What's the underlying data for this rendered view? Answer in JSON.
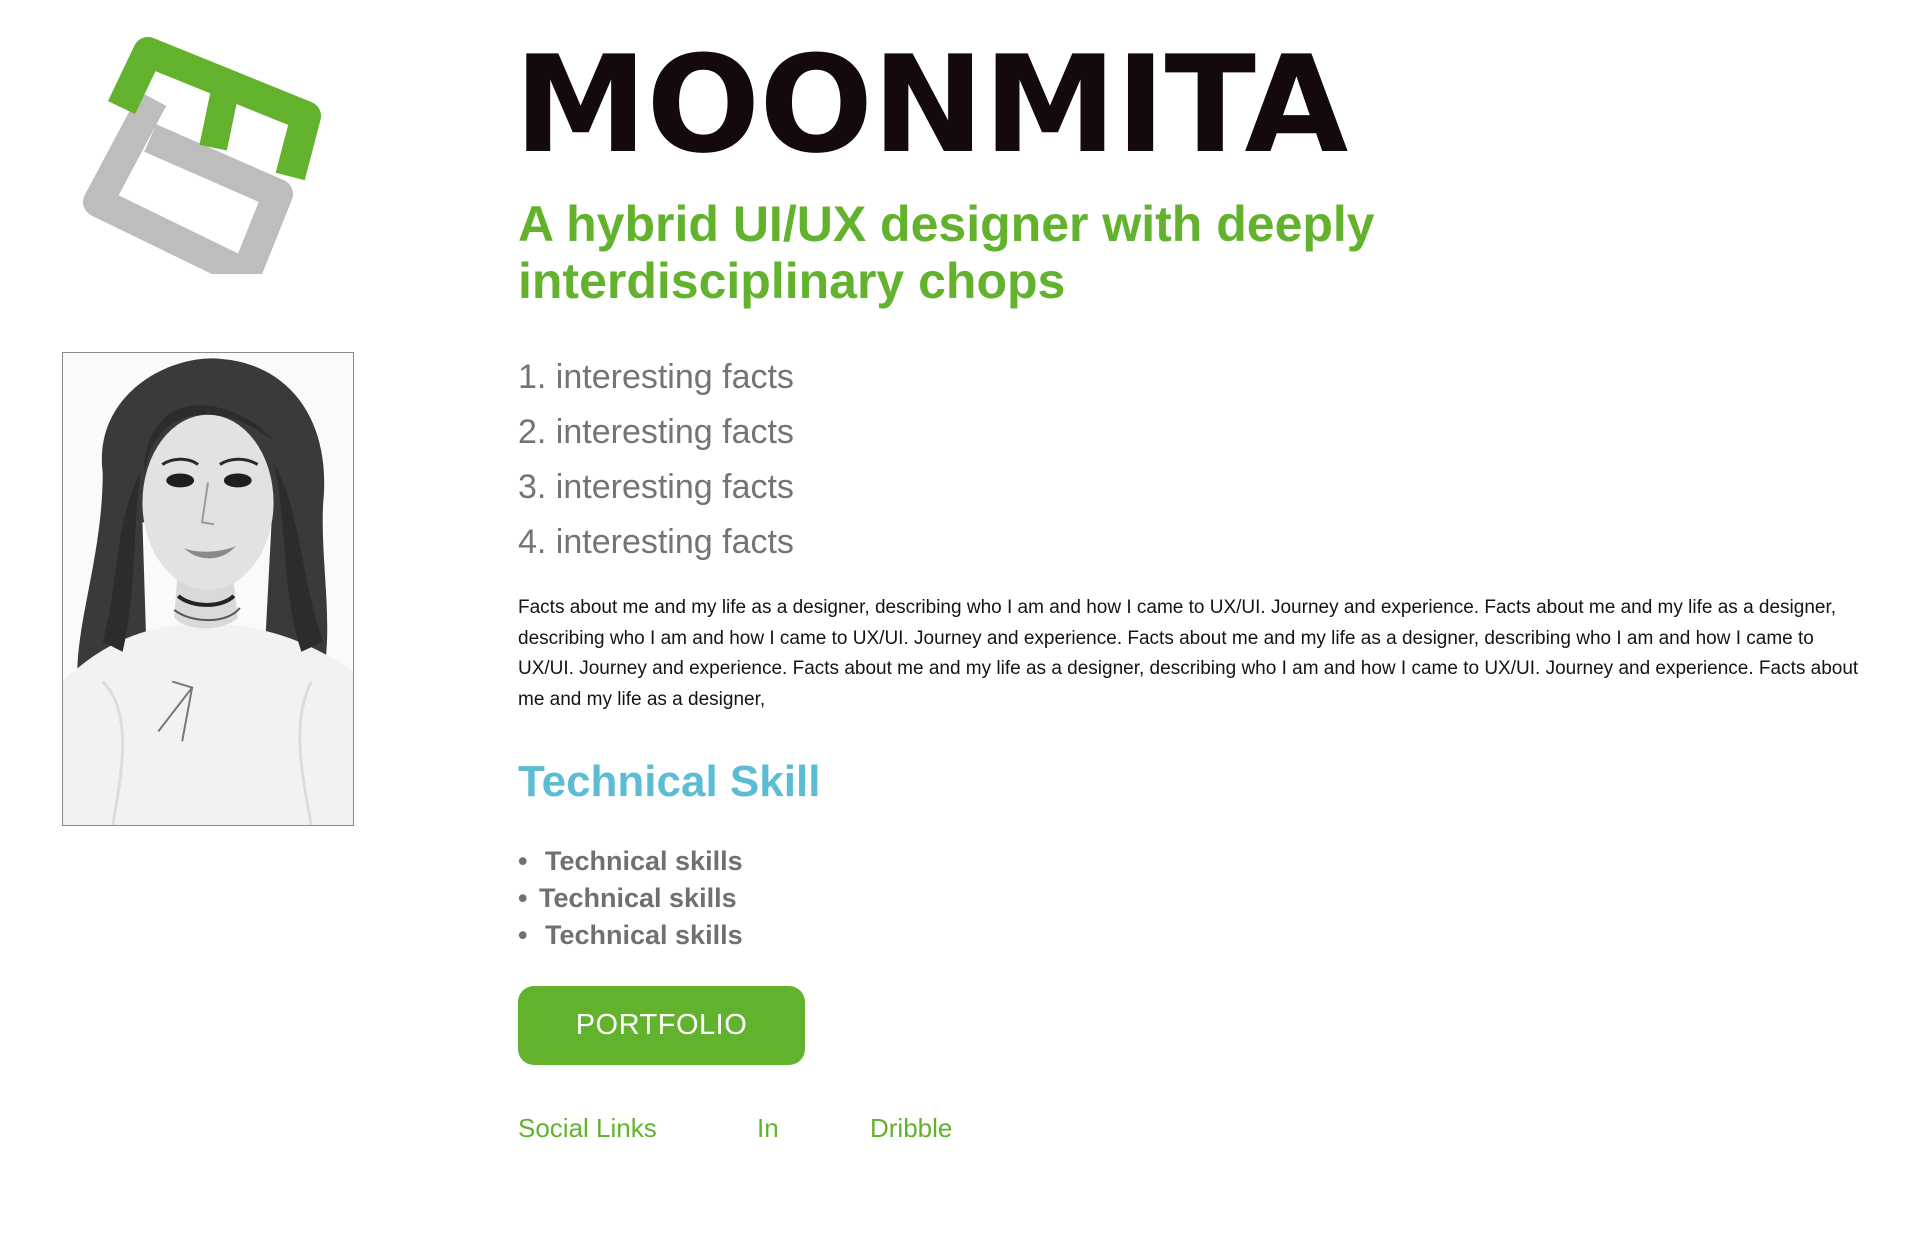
{
  "profile": {
    "name": "MOONMITA",
    "tagline": "A hybrid UI/UX designer with deeply interdisciplinary chops"
  },
  "facts": [
    "1. interesting facts",
    "2. interesting facts",
    "3. interesting facts",
    "4. interesting facts"
  ],
  "bio": "Facts about me and my life as a designer, describing who I am and how I came to UX/UI. Journey and experience. Facts about me and my life as a designer, describing who I am and how I came to UX/UI. Journey and experience. Facts about me and my life as a designer, describing who I am and how I came to UX/UI. Journey and experience. Facts about me and my life as a designer, describing who I am and how I came to UX/UI. Journey and experience. Facts about me and my life as a designer,",
  "skills": {
    "heading": "Technical Skill",
    "bullet": "•",
    "items": [
      "Technical skills",
      "Technical skills",
      "Technical skills"
    ]
  },
  "portfolio_button": {
    "label": "PORTFOLIO"
  },
  "social": {
    "label": "Social Links",
    "links": [
      "In",
      "Dribble"
    ]
  },
  "colors": {
    "brand_green": "#63b22e",
    "logo_grey": "#bdbdbd",
    "heading_blue": "#5bbcd4",
    "muted_grey": "#747474",
    "name_black": "#140a0c"
  },
  "icons": {
    "logo": "stylized-e-logo-icon",
    "photo": "profile-photo"
  }
}
